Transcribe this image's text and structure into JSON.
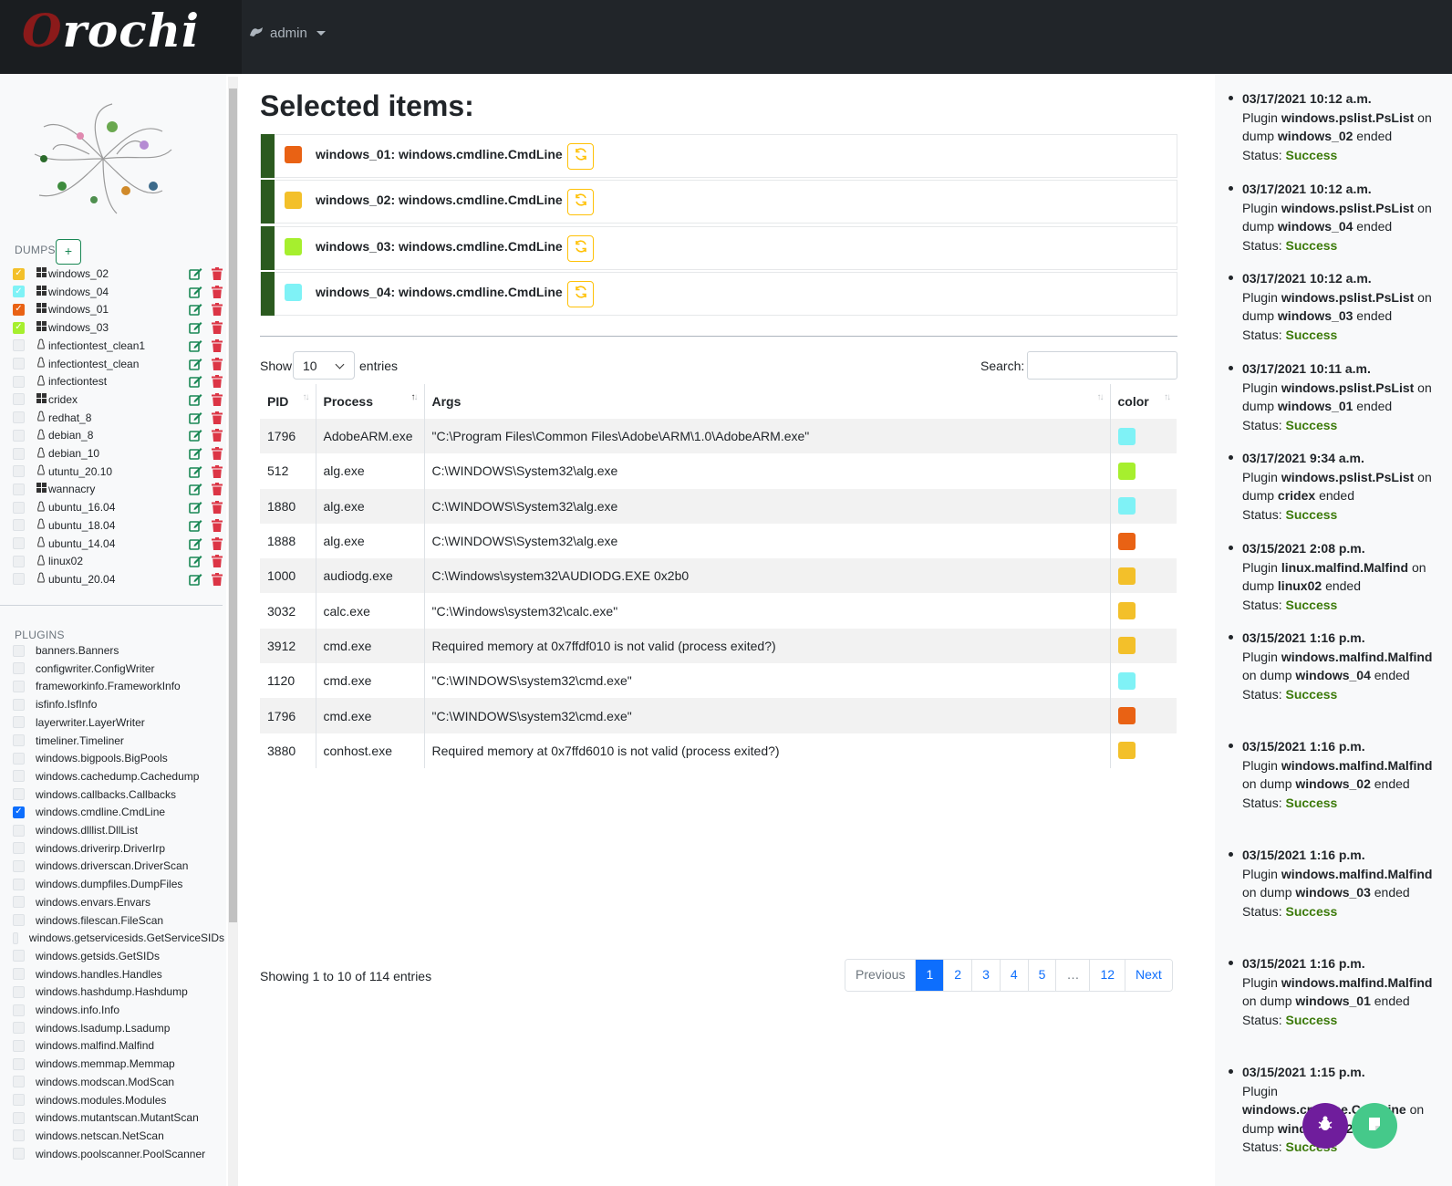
{
  "app": {
    "logo": "Orochi",
    "user": "admin"
  },
  "sidebar": {
    "dumps_title": "DUMPS",
    "add_label": "+",
    "dumps": [
      {
        "label": "windows_02",
        "os": "windows",
        "checked": true,
        "color": "#f3c02a"
      },
      {
        "label": "windows_04",
        "os": "windows",
        "checked": true,
        "color": "#7ff2f6"
      },
      {
        "label": "windows_01",
        "os": "windows",
        "checked": true,
        "color": "#e96214"
      },
      {
        "label": "windows_03",
        "os": "windows",
        "checked": true,
        "color": "#a6ef2e"
      },
      {
        "label": "infectiontest_clean1",
        "os": "linux",
        "checked": false
      },
      {
        "label": "infectiontest_clean",
        "os": "linux",
        "checked": false
      },
      {
        "label": "infectiontest",
        "os": "linux",
        "checked": false
      },
      {
        "label": "cridex",
        "os": "windows",
        "checked": false
      },
      {
        "label": "redhat_8",
        "os": "linux",
        "checked": false
      },
      {
        "label": "debian_8",
        "os": "linux",
        "checked": false
      },
      {
        "label": "debian_10",
        "os": "linux",
        "checked": false
      },
      {
        "label": "utuntu_20.10",
        "os": "linux",
        "checked": false
      },
      {
        "label": "wannacry",
        "os": "windows",
        "checked": false
      },
      {
        "label": "ubuntu_16.04",
        "os": "linux",
        "checked": false
      },
      {
        "label": "ubuntu_18.04",
        "os": "linux",
        "checked": false
      },
      {
        "label": "ubuntu_14.04",
        "os": "linux",
        "checked": false
      },
      {
        "label": "linux02",
        "os": "linux",
        "checked": false
      },
      {
        "label": "ubuntu_20.04",
        "os": "linux",
        "checked": false
      }
    ],
    "plugins_title": "PLUGINS",
    "plugins": [
      {
        "label": "banners.Banners",
        "checked": false
      },
      {
        "label": "configwriter.ConfigWriter",
        "checked": false
      },
      {
        "label": "frameworkinfo.FrameworkInfo",
        "checked": false
      },
      {
        "label": "isfinfo.IsfInfo",
        "checked": false
      },
      {
        "label": "layerwriter.LayerWriter",
        "checked": false
      },
      {
        "label": "timeliner.Timeliner",
        "checked": false
      },
      {
        "label": "windows.bigpools.BigPools",
        "checked": false
      },
      {
        "label": "windows.cachedump.Cachedump",
        "checked": false
      },
      {
        "label": "windows.callbacks.Callbacks",
        "checked": false
      },
      {
        "label": "windows.cmdline.CmdLine",
        "checked": true
      },
      {
        "label": "windows.dlllist.DllList",
        "checked": false
      },
      {
        "label": "windows.driverirp.DriverIrp",
        "checked": false
      },
      {
        "label": "windows.driverscan.DriverScan",
        "checked": false
      },
      {
        "label": "windows.dumpfiles.DumpFiles",
        "checked": false
      },
      {
        "label": "windows.envars.Envars",
        "checked": false
      },
      {
        "label": "windows.filescan.FileScan",
        "checked": false
      },
      {
        "label": "windows.getservicesids.GetServiceSIDs",
        "checked": false
      },
      {
        "label": "windows.getsids.GetSIDs",
        "checked": false
      },
      {
        "label": "windows.handles.Handles",
        "checked": false
      },
      {
        "label": "windows.hashdump.Hashdump",
        "checked": false
      },
      {
        "label": "windows.info.Info",
        "checked": false
      },
      {
        "label": "windows.lsadump.Lsadump",
        "checked": false
      },
      {
        "label": "windows.malfind.Malfind",
        "checked": false
      },
      {
        "label": "windows.memmap.Memmap",
        "checked": false
      },
      {
        "label": "windows.modscan.ModScan",
        "checked": false
      },
      {
        "label": "windows.modules.Modules",
        "checked": false
      },
      {
        "label": "windows.mutantscan.MutantScan",
        "checked": false
      },
      {
        "label": "windows.netscan.NetScan",
        "checked": false
      },
      {
        "label": "windows.poolscanner.PoolScanner",
        "checked": false
      }
    ]
  },
  "main": {
    "title": "Selected items:",
    "selected": [
      {
        "label": "windows_01: windows.cmdline.CmdLine",
        "color": "#e96214"
      },
      {
        "label": "windows_02: windows.cmdline.CmdLine",
        "color": "#f3c02a"
      },
      {
        "label": "windows_03: windows.cmdline.CmdLine",
        "color": "#a6ef2e"
      },
      {
        "label": "windows_04: windows.cmdline.CmdLine",
        "color": "#7ff2f6"
      }
    ],
    "show_label": "Show",
    "entries_value": "10",
    "entries_label": "entries",
    "search_label": "Search:",
    "search_value": "",
    "columns": [
      "PID",
      "Process",
      "Args",
      "color"
    ],
    "rows": [
      {
        "pid": "1796",
        "process": "AdobeARM.exe",
        "args": "\"C:\\Program Files\\Common Files\\Adobe\\ARM\\1.0\\AdobeARM.exe\"",
        "color": "#7ff2f6"
      },
      {
        "pid": "512",
        "process": "alg.exe",
        "args": "C:\\WINDOWS\\System32\\alg.exe",
        "color": "#a6ef2e"
      },
      {
        "pid": "1880",
        "process": "alg.exe",
        "args": "C:\\WINDOWS\\System32\\alg.exe",
        "color": "#7ff2f6"
      },
      {
        "pid": "1888",
        "process": "alg.exe",
        "args": "C:\\WINDOWS\\System32\\alg.exe",
        "color": "#e96214"
      },
      {
        "pid": "1000",
        "process": "audiodg.exe",
        "args": "C:\\Windows\\system32\\AUDIODG.EXE 0x2b0",
        "color": "#f3c02a"
      },
      {
        "pid": "3032",
        "process": "calc.exe",
        "args": "\"C:\\Windows\\system32\\calc.exe\"",
        "color": "#f3c02a"
      },
      {
        "pid": "3912",
        "process": "cmd.exe",
        "args": "Required memory at 0x7ffdf010 is not valid (process exited?)",
        "color": "#f3c02a"
      },
      {
        "pid": "1120",
        "process": "cmd.exe",
        "args": "\"C:\\WINDOWS\\system32\\cmd.exe\"",
        "color": "#7ff2f6"
      },
      {
        "pid": "1796",
        "process": "cmd.exe",
        "args": "\"C:\\WINDOWS\\system32\\cmd.exe\"",
        "color": "#e96214"
      },
      {
        "pid": "3880",
        "process": "conhost.exe",
        "args": "Required memory at 0x7ffd6010 is not valid (process exited?)",
        "color": "#f3c02a"
      }
    ],
    "info": "Showing 1 to 10 of 114 entries",
    "pagination": [
      "Previous",
      "1",
      "2",
      "3",
      "4",
      "5",
      "…",
      "12",
      "Next"
    ],
    "active_page": "1"
  },
  "log": [
    {
      "date": "03/17/2021 10:12 a.m.",
      "plugin": "windows.pslist.PsList",
      "dump": "windows_02",
      "status": "Success"
    },
    {
      "date": "03/17/2021 10:12 a.m.",
      "plugin": "windows.pslist.PsList",
      "dump": "windows_04",
      "status": "Success"
    },
    {
      "date": "03/17/2021 10:12 a.m.",
      "plugin": "windows.pslist.PsList",
      "dump": "windows_03",
      "status": "Success"
    },
    {
      "date": "03/17/2021 10:11 a.m.",
      "plugin": "windows.pslist.PsList",
      "dump": "windows_01",
      "status": "Success"
    },
    {
      "date": "03/17/2021 9:34 a.m.",
      "plugin": "windows.pslist.PsList",
      "dump": "cridex",
      "status": "Success"
    },
    {
      "date": "03/15/2021 2:08 p.m.",
      "plugin": "linux.malfind.Malfind",
      "dump": "linux02",
      "status": "Success"
    },
    {
      "date": "03/15/2021 1:16 p.m.",
      "plugin": "windows.malfind.Malfind",
      "dump": "windows_04",
      "status": "Success"
    },
    {
      "date": "03/15/2021 1:16 p.m.",
      "plugin": "windows.malfind.Malfind",
      "dump": "windows_02",
      "status": "Success"
    },
    {
      "date": "03/15/2021 1:16 p.m.",
      "plugin": "windows.malfind.Malfind",
      "dump": "windows_03",
      "status": "Success"
    },
    {
      "date": "03/15/2021 1:16 p.m.",
      "plugin": "windows.malfind.Malfind",
      "dump": "windows_01",
      "status": "Success"
    },
    {
      "date": "03/15/2021 1:15 p.m.",
      "plugin": "windows.cmdline.CmdLine",
      "dump": "windows_02",
      "status": "Success"
    }
  ],
  "log_text": {
    "plugin_word": "Plugin",
    "on_word": "on",
    "dump_word": "dump",
    "ended_word": "ended",
    "status_word": "Status:"
  },
  "colors": {
    "accent": "#0d6efd",
    "success": "#198754",
    "danger": "#dc3545",
    "warning": "#ffc107",
    "fab_left": "#6f1d9c",
    "fab_right": "#45c98a"
  },
  "icons": {
    "fab_left": "bug-icon",
    "fab_right": "note-icon"
  }
}
